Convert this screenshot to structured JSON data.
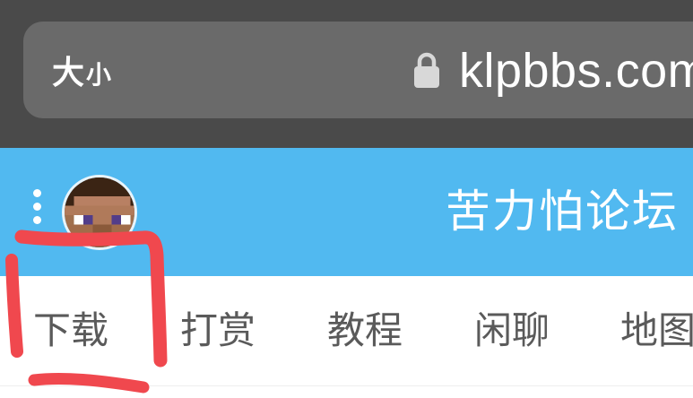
{
  "browser": {
    "text_size_big": "大",
    "text_size_small": "小",
    "url": "klpbbs.com",
    "icons": {
      "lock": "lock-icon"
    }
  },
  "site": {
    "title": "苦力怕论坛",
    "brand_color": "#51b9f0",
    "icons": {
      "menu": "more-vertical-icon",
      "avatar": "minecraft-steve-avatar"
    }
  },
  "nav": {
    "items": [
      {
        "label": "下载"
      },
      {
        "label": "打赏"
      },
      {
        "label": "教程"
      },
      {
        "label": "闲聊"
      },
      {
        "label": "地图"
      }
    ]
  },
  "annotation": {
    "color": "#f0484e",
    "target": "下载"
  }
}
